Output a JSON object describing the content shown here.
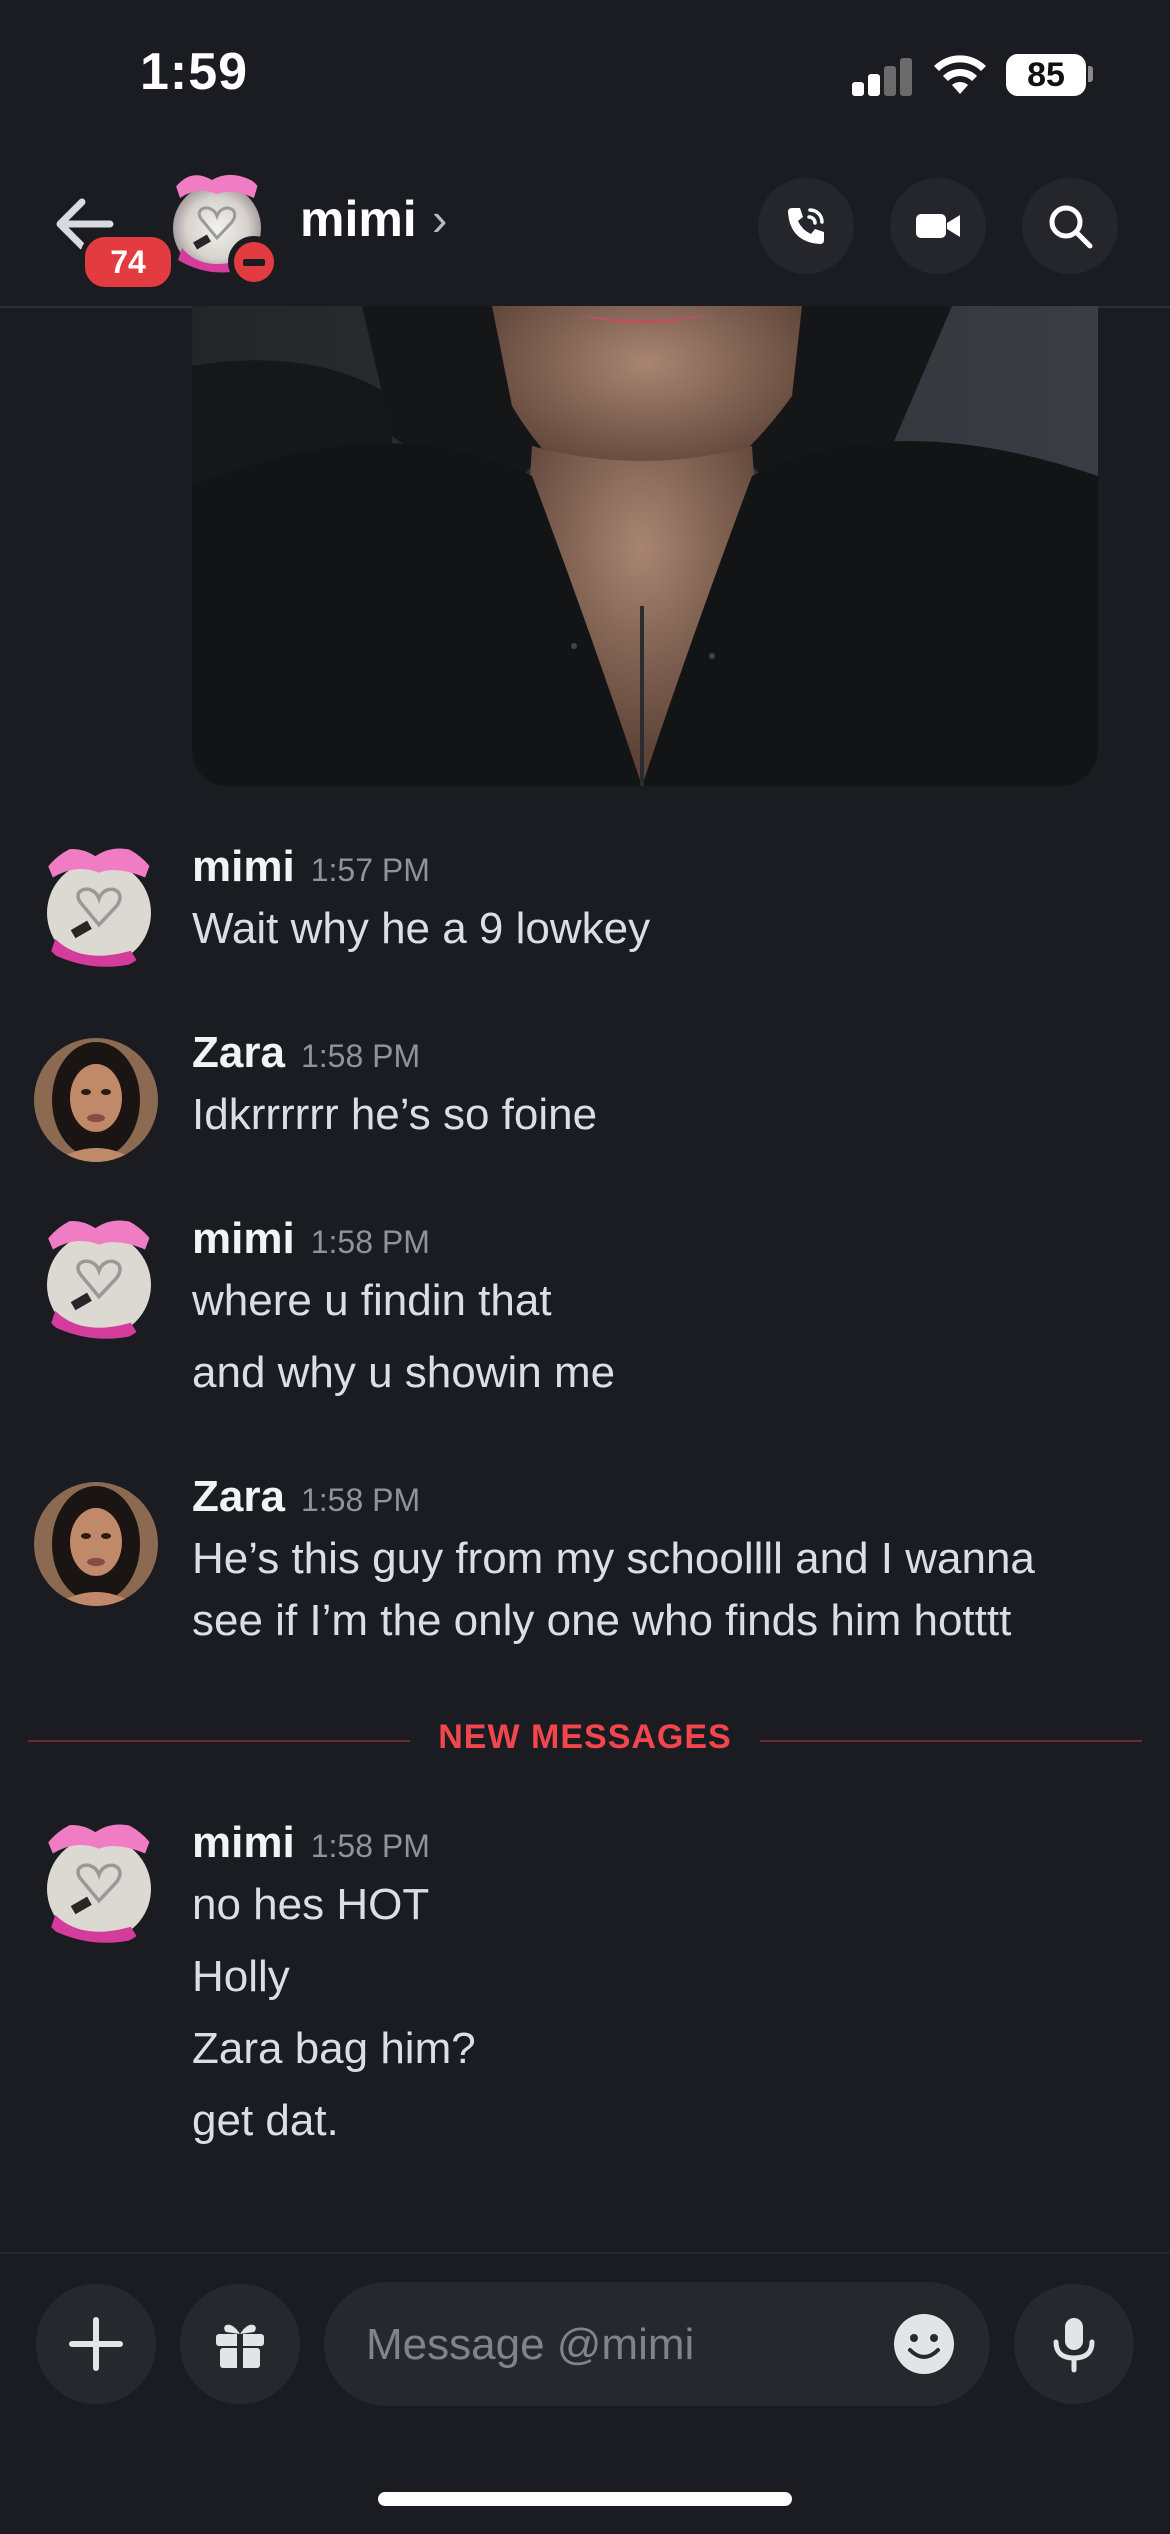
{
  "status_bar": {
    "time": "1:59",
    "battery": "85"
  },
  "header": {
    "badge_count": "74",
    "name": "mimi",
    "chevron": "›"
  },
  "messages": [
    {
      "author": "mimi",
      "time": "1:57 PM",
      "lines": [
        "Wait why he a 9 lowkey"
      ]
    },
    {
      "author": "Zara",
      "time": "1:58 PM",
      "lines": [
        "Idkrrrrrr he’s so foine"
      ]
    },
    {
      "author": "mimi",
      "time": "1:58 PM",
      "lines": [
        "where u findin that",
        "and why u showin me"
      ]
    },
    {
      "author": "Zara",
      "time": "1:58 PM",
      "lines": [
        "He’s this guy from my schoollll and I wanna",
        "see if I’m the only one who finds him hotttt"
      ]
    },
    {
      "author": "mimi",
      "time": "1:58 PM",
      "lines": [
        "no hes HOT",
        "Holly",
        "Zara bag him?",
        "get dat."
      ]
    }
  ],
  "divider": {
    "label": "NEW MESSAGES"
  },
  "composer": {
    "placeholder": "Message @mimi"
  },
  "colors": {
    "background": "#1b1c21",
    "new_messages_red": "#f0464c",
    "badge_red": "#e23b40"
  },
  "icons": [
    "back-arrow-icon",
    "phone-call-icon",
    "video-camera-icon",
    "search-icon",
    "plus-icon",
    "gift-icon",
    "emoji-icon",
    "microphone-icon"
  ]
}
